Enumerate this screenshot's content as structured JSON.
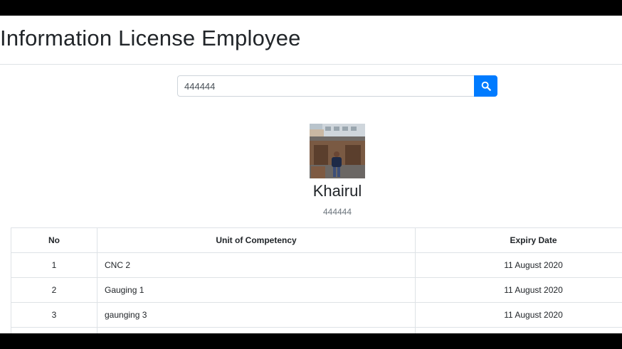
{
  "page": {
    "title": "Information License Employee"
  },
  "search": {
    "value": "444444",
    "button_icon": "search-icon"
  },
  "profile": {
    "name": "Khairul",
    "employee_id": "444444",
    "avatar": "profile-photo"
  },
  "table": {
    "headers": {
      "no": "No",
      "unit": "Unit of Competency",
      "expiry": "Expiry Date"
    },
    "rows": [
      {
        "no": "1",
        "unit": "CNC 2",
        "expiry": "11 August 2020"
      },
      {
        "no": "2",
        "unit": "Gauging 1",
        "expiry": "11 August 2020"
      },
      {
        "no": "3",
        "unit": "gaunging 3",
        "expiry": "11 August 2020"
      },
      {
        "no": "",
        "unit": "",
        "expiry": ""
      }
    ]
  },
  "colors": {
    "primary": "#007bff",
    "text": "#212529",
    "muted": "#6c757d",
    "border": "#dee2e6"
  }
}
